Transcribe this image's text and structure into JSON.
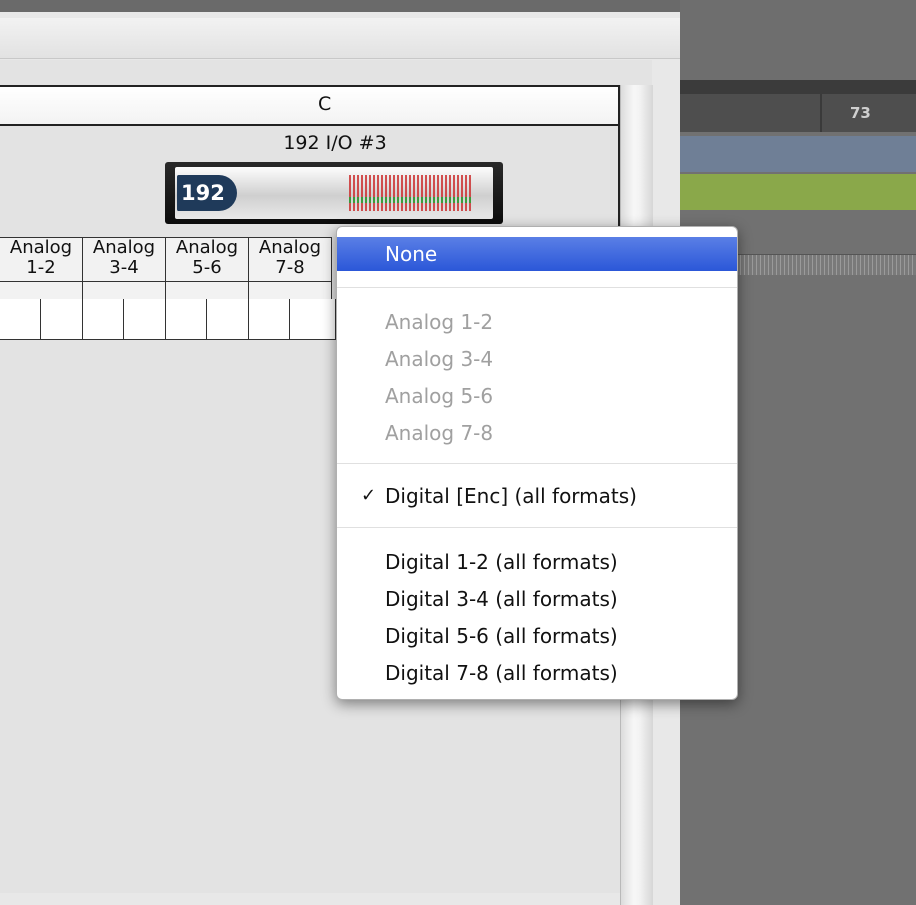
{
  "column_header": {
    "letter": "C"
  },
  "device": {
    "name": "192 I/O #3",
    "badge": "192"
  },
  "io_columns": [
    {
      "line1": "Analog",
      "line2": "1-2"
    },
    {
      "line1": "Analog",
      "line2": "3-4"
    },
    {
      "line1": "Analog",
      "line2": "5-6"
    },
    {
      "line1": "Analog",
      "line2": "7-8"
    }
  ],
  "track": {
    "number": "73"
  },
  "menu": {
    "items": [
      {
        "label": "None",
        "state": "highlighted"
      },
      {
        "label": "Analog 1-2",
        "state": "disabled"
      },
      {
        "label": "Analog 3-4",
        "state": "disabled"
      },
      {
        "label": "Analog 5-6",
        "state": "disabled"
      },
      {
        "label": "Analog 7-8",
        "state": "disabled"
      },
      {
        "label": "Digital [Enc] (all formats)",
        "state": "checked",
        "check": "✓"
      },
      {
        "label": "Digital 1-2 (all formats)",
        "state": "normal"
      },
      {
        "label": "Digital 3-4 (all formats)",
        "state": "normal"
      },
      {
        "label": "Digital 5-6 (all formats)",
        "state": "normal"
      },
      {
        "label": "Digital 7-8 (all formats)",
        "state": "normal"
      }
    ]
  },
  "colors": {
    "menu_highlight": "#2b57d8",
    "track_blue": "#6f7f96",
    "track_green": "#8aa84a",
    "disabled_text": "#a0a0a0"
  }
}
